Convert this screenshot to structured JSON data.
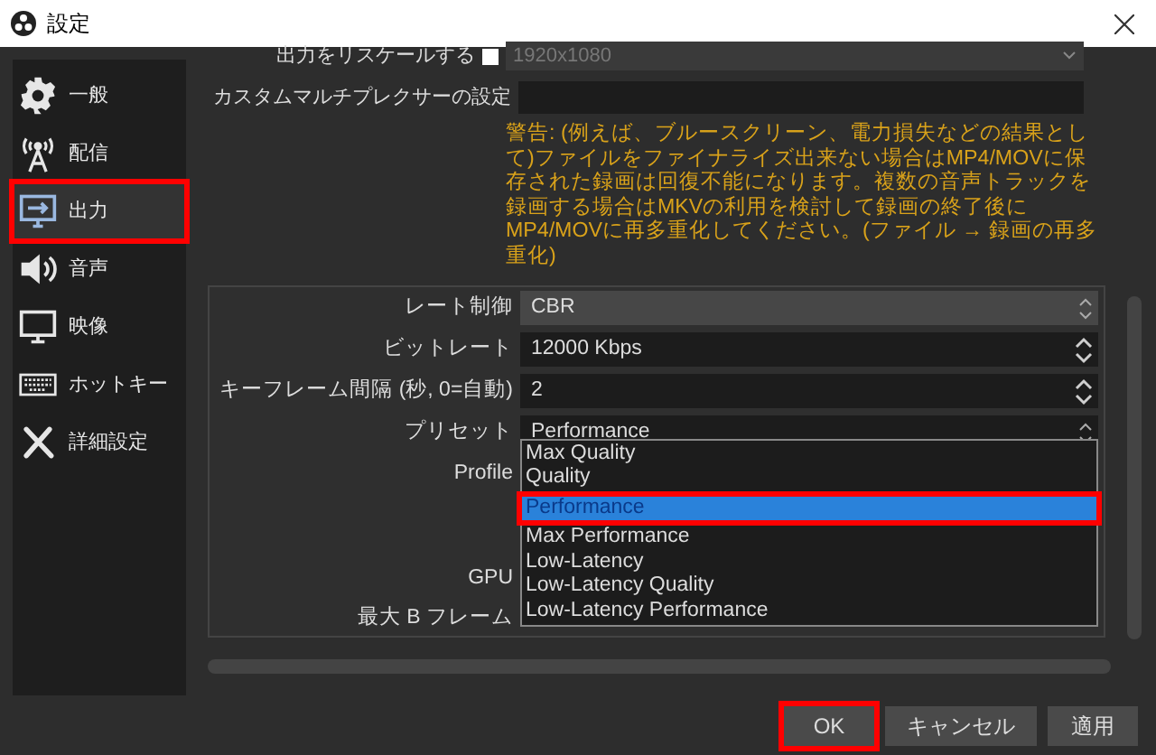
{
  "window": {
    "title": "設定"
  },
  "sidebar": {
    "items": [
      {
        "label": "一般",
        "selected": false,
        "highlighted": false
      },
      {
        "label": "配信",
        "selected": false,
        "highlighted": false
      },
      {
        "label": "出力",
        "selected": true,
        "highlighted": true
      },
      {
        "label": "音声",
        "selected": false,
        "highlighted": false
      },
      {
        "label": "映像",
        "selected": false,
        "highlighted": false
      },
      {
        "label": "ホットキー",
        "selected": false,
        "highlighted": false
      },
      {
        "label": "詳細設定",
        "selected": false,
        "highlighted": false
      }
    ]
  },
  "rescale": {
    "label": "出力をリスケールする",
    "checked": false,
    "value": "1920x1080",
    "disabled": true
  },
  "custom_muxer": {
    "label": "カスタムマルチプレクサーの設定"
  },
  "warning": "警告: (例えば、ブルースクリーン、電力損失などの結果として)ファイルをファイナライズ出来ない場合はMP4/MOVに保存された録画は回復不能になります。複数の音声トラックを録画する場合はMKVの利用を検討して録画の終了後にMP4/MOVに再多重化してください。(ファイル → 録画の再多重化)",
  "encoder_settings": [
    {
      "label": "レート制御",
      "kind": "select",
      "value": "CBR"
    },
    {
      "label": "ビットレート",
      "kind": "spin",
      "value": "12000 Kbps"
    },
    {
      "label": "キーフレーム間隔 (秒, 0=自動)",
      "kind": "spin",
      "value": "2"
    },
    {
      "label": "プリセット",
      "kind": "select",
      "value": "Performance"
    },
    {
      "label": "Profile",
      "kind": "hidden"
    },
    {
      "kind": "blank"
    },
    {
      "kind": "blank"
    },
    {
      "label": "GPU",
      "kind": "hidden"
    },
    {
      "label": "最大 B フレーム",
      "kind": "hidden"
    }
  ],
  "preset_dropdown": {
    "options": [
      {
        "label": "Max Quality",
        "selected": false,
        "highlighted": false
      },
      {
        "label": "Quality",
        "selected": false,
        "highlighted": false
      },
      {
        "label": "Performance",
        "selected": true,
        "highlighted": true
      },
      {
        "label": "Max Performance",
        "selected": false,
        "highlighted": false
      },
      {
        "label": "Low-Latency",
        "selected": false,
        "highlighted": false
      },
      {
        "label": "Low-Latency Quality",
        "selected": false,
        "highlighted": false
      },
      {
        "label": "Low-Latency Performance",
        "selected": false,
        "highlighted": false
      }
    ]
  },
  "buttons": [
    {
      "label": "OK",
      "highlighted": true
    },
    {
      "label": "キャンセル",
      "highlighted": false
    },
    {
      "label": "適用",
      "highlighted": false
    }
  ]
}
